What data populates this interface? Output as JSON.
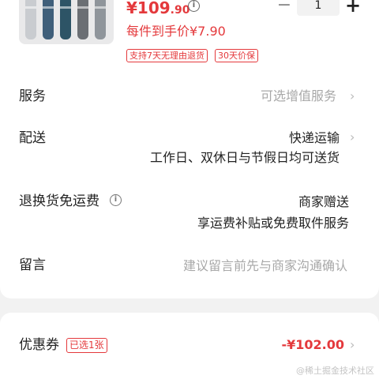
{
  "product": {
    "price_symbol": "¥",
    "price_int": "109",
    "price_dec": ".90",
    "promo": "每件到手价¥7.90",
    "quantity": "1",
    "minus_label": "−",
    "plus_label": "+",
    "tags": [
      "支持7天无理由退货",
      "30天价保"
    ],
    "sock_colors": [
      "#3f5f7a",
      "#2d5466",
      "#6b6f74",
      "#8f959b",
      "#c9ccd0"
    ]
  },
  "rows": {
    "service": {
      "label": "服务",
      "value": "可选增值服务"
    },
    "delivery": {
      "label": "配送",
      "value": "快递运输",
      "sub": "工作日、双休日与节假日均可送货"
    },
    "returns": {
      "label": "退换货免运费",
      "value": "商家赠送",
      "sub": "享运费补贴或免费取件服务"
    },
    "message": {
      "label": "留言",
      "placeholder": "建议留言前先与商家沟通确认"
    }
  },
  "coupon": {
    "label": "优惠券",
    "badge": "已选1张",
    "amount": "-¥102.00"
  },
  "watermark": "@稀土掘金技术社区",
  "icons": {
    "chevron": "chevron-right-icon",
    "info": "info-icon"
  },
  "colors": {
    "accent": "#e4393c",
    "muted": "#a8a8a8"
  }
}
